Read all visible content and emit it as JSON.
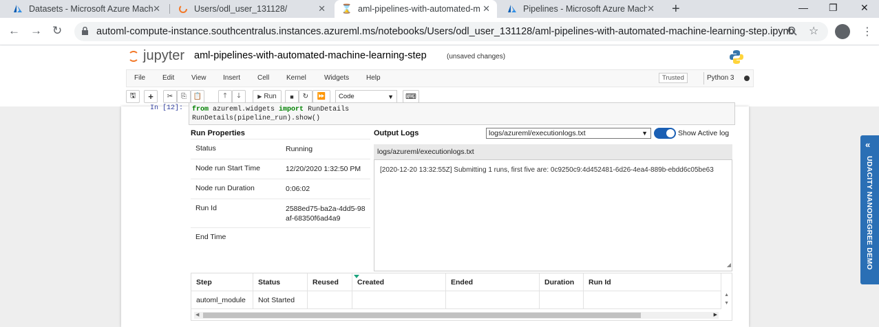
{
  "browser": {
    "tabs": [
      {
        "title": "Datasets - Microsoft Azure Mach",
        "icon": "azure-icon"
      },
      {
        "title": "Users/odl_user_131128/",
        "icon": "jupyter-spinner-icon"
      },
      {
        "title": "aml-pipelines-with-automated-m",
        "icon": "hourglass-icon"
      },
      {
        "title": "Pipelines - Microsoft Azure Mach",
        "icon": "azure-icon"
      }
    ],
    "url": "automl-compute-instance.southcentralus.instances.azureml.ms/notebooks/Users/odl_user_131128/aml-pipelines-with-automated-machine-learning-step.ipynb"
  },
  "jupyter": {
    "logo_text": "jupyter",
    "notebook_title": "aml-pipelines-with-automated-machine-learning-step",
    "save_status": "(unsaved changes)",
    "menu": [
      "File",
      "Edit",
      "View",
      "Insert",
      "Cell",
      "Kernel",
      "Widgets",
      "Help"
    ],
    "trusted": "Trusted",
    "kernel": "Python 3",
    "toolbar": {
      "run_label": "Run",
      "cell_type": "Code"
    }
  },
  "cell": {
    "prompt": "In [12]:",
    "code_line1_kw1": "from",
    "code_line1_mid": " azureml.widgets ",
    "code_line1_kw2": "import",
    "code_line1_end": " RunDetails",
    "code_line2": "RunDetails(pipeline_run).show()"
  },
  "widget": {
    "run_properties_title": "Run Properties",
    "properties": [
      {
        "key": "Status",
        "value": "Running"
      },
      {
        "key": "Node run Start Time",
        "value": "12/20/2020 1:32:50 PM"
      },
      {
        "key": "Node run Duration",
        "value": "0:06:02"
      },
      {
        "key": "Run Id",
        "value": "2588ed75-ba2a-4dd5-98af-68350f6ad4a9"
      },
      {
        "key": "End Time",
        "value": ""
      }
    ],
    "output_logs_title": "Output Logs",
    "log_file_selected": "logs/azureml/executionlogs.txt",
    "show_active_label": "Show Active log",
    "log_header": "logs/azureml/executionlogs.txt",
    "log_text": "[2020-12-20 13:32:55Z] Submitting 1 runs, first five are: 0c9250c9:4d452481-6d26-4ea4-889b-ebdd6c05be63",
    "steps": {
      "columns": [
        "Step",
        "Status",
        "Reused",
        "Created",
        "Ended",
        "Duration",
        "Run Id"
      ],
      "rows": [
        [
          "automl_module",
          "Not Started",
          "",
          "",
          "",
          "",
          ""
        ]
      ]
    }
  },
  "side_badge": "UDACITY NANODEGREE DEMO",
  "colors": {
    "status_running": "#1a6fc4",
    "toggle_on": "#1a5fb4",
    "side_badge": "#2a6fb5",
    "jupyter_orange": "#f37726"
  }
}
